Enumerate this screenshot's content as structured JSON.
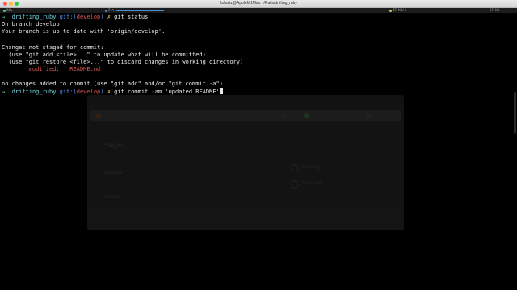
{
  "window": {
    "title": "kobaltz@AppleM1Max:~/Rails/drifting_ruby"
  },
  "statusbar": {
    "left": "90%",
    "cpu": "21%",
    "right1": "47 KB/s",
    "right2": "67 KB"
  },
  "terminal": {
    "prompt_arrow": "→",
    "prompt_dir": "drifting_ruby",
    "prompt_git": "git:(",
    "prompt_branch": "develop",
    "prompt_git_close": ")",
    "prompt_mark": "✗",
    "cmd1": "git status",
    "out_branch": "On branch develop",
    "out_uptodate": "Your branch is up to date with 'origin/develop'.",
    "out_not_staged": "Changes not staged for commit:",
    "out_hint1": "  (use \"git add <file>...\" to update what will be committed)",
    "out_hint2": "  (use \"git restore <file>...\" to discard changes in working directory)",
    "out_modified_label": "        modified:",
    "out_modified_file": "   README.md",
    "out_no_changes": "no changes added to commit (use \"git add\" and/or \"git commit -a\")",
    "cmd2": "git commit -am 'updated README'"
  },
  "overlay": {
    "nav_label": "Stages",
    "field1": "Calendar",
    "field2": "Actions",
    "item1": "Incoming",
    "item2": "Outbound"
  },
  "colors": {
    "prompt_arrow": "#58c48a",
    "prompt_dir": "#6fd5e0",
    "git_label": "#4d8fe8",
    "branch": "#e05252",
    "dirty_mark": "#d8c24a",
    "modified": "#e05252"
  }
}
